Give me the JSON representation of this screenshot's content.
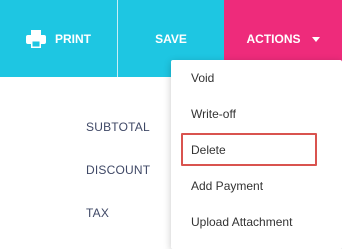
{
  "toolbar": {
    "print_label": "PRINT",
    "save_label": "SAVE",
    "actions_label": "ACTIONS"
  },
  "summary": {
    "labels": [
      "SUBTOTAL",
      "DISCOUNT",
      "TAX"
    ]
  },
  "actions_menu": {
    "items": [
      "Void",
      "Write-off",
      "Delete",
      "Add Payment",
      "Upload Attachment"
    ],
    "highlighted_item": "Delete"
  },
  "colors": {
    "toolbar_cyan": "#1ec6e2",
    "actions_pink": "#ee2b7b",
    "highlight_red": "#d9534f",
    "label_text": "#3f4866"
  },
  "icons": {
    "print": "printer-icon",
    "actions_caret": "caret-down-icon"
  }
}
